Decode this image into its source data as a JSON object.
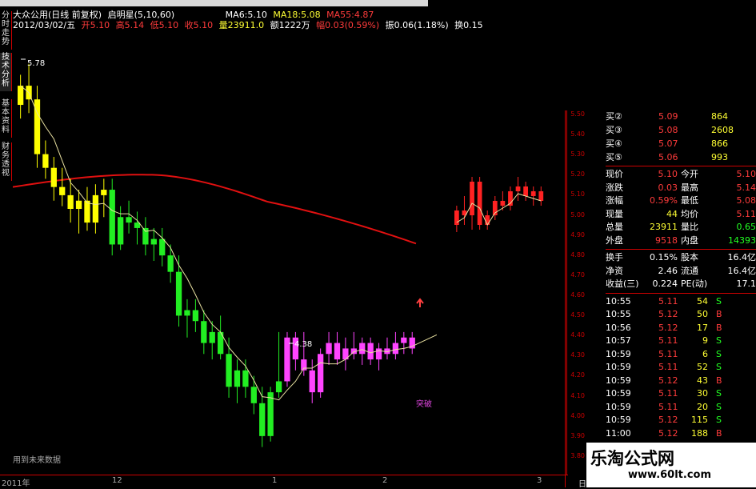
{
  "header": {
    "title": "大众公用(日线 前复权)",
    "indicator": "启明星(5,10,60)",
    "ma": [
      {
        "label": "MA6:",
        "value": "5.10"
      },
      {
        "label": "MA18:",
        "value": "5.08"
      },
      {
        "label": "MA55:",
        "value": "4.87"
      }
    ],
    "date": "2012/03/02/五",
    "open": "开5.10",
    "high": "高5.14",
    "low": "低5.10",
    "close": "收5.10",
    "volume": "量23911.0",
    "amount": "额1222万",
    "change": "幅0.03(0.59%)",
    "amplitude": "振0.06(1.18%)",
    "turnover": "换0.15"
  },
  "left_tabs": [
    "分时走势",
    "技术分析",
    "基本资料",
    "财务透视"
  ],
  "chart": {
    "high_label": "5.78",
    "low_label": "4.38",
    "signal_label": "突破",
    "footer_note": "用到未来数据"
  },
  "x_axis": {
    "labels": [
      "2011年",
      "12",
      "1",
      "2",
      "3"
    ]
  },
  "y_axis": {
    "ticks": [
      "5.50",
      "5.40",
      "5.30",
      "5.20",
      "5.10",
      "5.00",
      "4.90",
      "4.80",
      "4.70",
      "4.60",
      "4.50",
      "4.40",
      "4.30",
      "4.20",
      "4.10",
      "4.00",
      "3.90",
      "3.80"
    ]
  },
  "quote_panel": {
    "bids": [
      {
        "label": "买②",
        "price": "5.09",
        "vol": "864"
      },
      {
        "label": "买③",
        "price": "5.08",
        "vol": "2608"
      },
      {
        "label": "买④",
        "price": "5.07",
        "vol": "866"
      },
      {
        "label": "买⑤",
        "price": "5.06",
        "vol": "993"
      }
    ],
    "stats": [
      {
        "l1": "现价",
        "v1": "5.10",
        "l2": "今开",
        "v2": "5.10"
      },
      {
        "l1": "涨跌",
        "v1": "0.03",
        "l2": "最高",
        "v2": "5.14"
      },
      {
        "l1": "涨幅",
        "v1": "0.59%",
        "l2": "最低",
        "v2": "5.08"
      },
      {
        "l1": "现量",
        "v1": "44",
        "l2": "均价",
        "v2": "5.11"
      },
      {
        "l1": "总量",
        "v1": "23911",
        "l2": "量比",
        "v2": "0.65"
      },
      {
        "l1": "外盘",
        "v1": "9518",
        "l2": "内盘",
        "v2": "14393"
      }
    ],
    "fund": [
      {
        "l1": "换手",
        "v1": "0.15%",
        "l2": "股本",
        "v2": "16.4亿"
      },
      {
        "l1": "净资",
        "v1": "2.46",
        "l2": "流通",
        "v2": "16.4亿"
      },
      {
        "l1": "收益(三)",
        "v1": "0.224",
        "l2": "PE(动)",
        "v2": "17.1"
      }
    ],
    "ticks": [
      {
        "time": "10:55",
        "price": "5.11",
        "vol": "54",
        "side": "S"
      },
      {
        "time": "10:55",
        "price": "5.12",
        "vol": "50",
        "side": "B"
      },
      {
        "time": "10:56",
        "price": "5.12",
        "vol": "17",
        "side": "B"
      },
      {
        "time": "10:57",
        "price": "5.11",
        "vol": "9",
        "side": "S"
      },
      {
        "time": "10:59",
        "price": "5.11",
        "vol": "6",
        "side": "S"
      },
      {
        "time": "10:59",
        "price": "5.11",
        "vol": "52",
        "side": "S"
      },
      {
        "time": "10:59",
        "price": "5.12",
        "vol": "43",
        "side": "B"
      },
      {
        "time": "10:59",
        "price": "5.11",
        "vol": "30",
        "side": "S"
      },
      {
        "time": "10:59",
        "price": "5.11",
        "vol": "20",
        "side": "S"
      },
      {
        "time": "10:59",
        "price": "5.12",
        "vol": "115",
        "side": "S"
      },
      {
        "time": "11:00",
        "price": "5.12",
        "vol": "188",
        "side": "B"
      }
    ]
  },
  "bottom": {
    "period": "日线"
  },
  "watermark": {
    "line1": "乐淘公式网",
    "line2": "www.60lt.com"
  },
  "candles": [
    {
      "o": 5.63,
      "h": 5.74,
      "l": 5.58,
      "c": 5.7,
      "color": "yellow"
    },
    {
      "o": 5.7,
      "h": 5.78,
      "l": 5.6,
      "c": 5.65,
      "color": "yellow"
    },
    {
      "o": 5.65,
      "h": 5.7,
      "l": 5.4,
      "c": 5.45,
      "color": "yellow"
    },
    {
      "o": 5.45,
      "h": 5.5,
      "l": 5.36,
      "c": 5.4,
      "color": "yellow"
    },
    {
      "o": 5.4,
      "h": 5.44,
      "l": 5.28,
      "c": 5.33,
      "color": "yellow"
    },
    {
      "o": 5.33,
      "h": 5.4,
      "l": 5.26,
      "c": 5.3,
      "color": "yellow"
    },
    {
      "o": 5.3,
      "h": 5.36,
      "l": 5.2,
      "c": 5.25,
      "color": "yellow"
    },
    {
      "o": 5.25,
      "h": 5.32,
      "l": 5.16,
      "c": 5.28,
      "color": "yellow"
    },
    {
      "o": 5.28,
      "h": 5.33,
      "l": 5.17,
      "c": 5.2,
      "color": "yellow"
    },
    {
      "o": 5.2,
      "h": 5.34,
      "l": 5.16,
      "c": 5.3,
      "color": "yellow"
    },
    {
      "o": 5.3,
      "h": 5.36,
      "l": 5.22,
      "c": 5.32,
      "color": "yellow"
    },
    {
      "o": 5.32,
      "h": 5.36,
      "l": 5.08,
      "c": 5.12,
      "color": "green"
    },
    {
      "o": 5.12,
      "h": 5.26,
      "l": 5.1,
      "c": 5.22,
      "color": "green"
    },
    {
      "o": 5.22,
      "h": 5.28,
      "l": 5.16,
      "c": 5.2,
      "color": "green"
    },
    {
      "o": 5.2,
      "h": 5.24,
      "l": 5.12,
      "c": 5.18,
      "color": "green"
    },
    {
      "o": 5.18,
      "h": 5.22,
      "l": 5.08,
      "c": 5.12,
      "color": "green"
    },
    {
      "o": 5.12,
      "h": 5.18,
      "l": 5.06,
      "c": 5.14,
      "color": "green"
    },
    {
      "o": 5.14,
      "h": 5.18,
      "l": 5.04,
      "c": 5.08,
      "color": "green"
    },
    {
      "o": 5.08,
      "h": 5.12,
      "l": 4.98,
      "c": 5.02,
      "color": "green"
    },
    {
      "o": 5.02,
      "h": 5.08,
      "l": 4.82,
      "c": 4.86,
      "color": "green"
    },
    {
      "o": 4.86,
      "h": 4.92,
      "l": 4.78,
      "c": 4.88,
      "color": "green"
    },
    {
      "o": 4.88,
      "h": 4.92,
      "l": 4.8,
      "c": 4.84,
      "color": "green"
    },
    {
      "o": 4.84,
      "h": 4.88,
      "l": 4.72,
      "c": 4.76,
      "color": "green"
    },
    {
      "o": 4.76,
      "h": 4.84,
      "l": 4.7,
      "c": 4.8,
      "color": "green"
    },
    {
      "o": 4.8,
      "h": 4.86,
      "l": 4.7,
      "c": 4.72,
      "color": "green"
    },
    {
      "o": 4.72,
      "h": 4.78,
      "l": 4.56,
      "c": 4.6,
      "color": "green"
    },
    {
      "o": 4.6,
      "h": 4.7,
      "l": 4.54,
      "c": 4.66,
      "color": "green"
    },
    {
      "o": 4.66,
      "h": 4.7,
      "l": 4.56,
      "c": 4.6,
      "color": "green"
    },
    {
      "o": 4.6,
      "h": 4.64,
      "l": 4.5,
      "c": 4.54,
      "color": "green"
    },
    {
      "o": 4.54,
      "h": 4.6,
      "l": 4.38,
      "c": 4.42,
      "color": "green"
    },
    {
      "o": 4.42,
      "h": 4.6,
      "l": 4.4,
      "c": 4.58,
      "color": "green"
    },
    {
      "o": 4.58,
      "h": 4.8,
      "l": 4.56,
      "c": 4.62,
      "color": "green"
    },
    {
      "o": 4.62,
      "h": 4.8,
      "l": 4.6,
      "c": 4.78,
      "color": "magenta"
    },
    {
      "o": 4.78,
      "h": 4.8,
      "l": 4.66,
      "c": 4.7,
      "color": "magenta"
    },
    {
      "o": 4.7,
      "h": 4.8,
      "l": 4.64,
      "c": 4.66,
      "color": "magenta"
    },
    {
      "o": 4.66,
      "h": 4.7,
      "l": 4.54,
      "c": 4.58,
      "color": "magenta"
    },
    {
      "o": 4.58,
      "h": 4.74,
      "l": 4.56,
      "c": 4.72,
      "color": "magenta"
    },
    {
      "o": 4.72,
      "h": 4.8,
      "l": 4.68,
      "c": 4.76,
      "color": "magenta"
    },
    {
      "o": 4.76,
      "h": 4.8,
      "l": 4.68,
      "c": 4.7,
      "color": "magenta"
    },
    {
      "o": 4.7,
      "h": 4.78,
      "l": 4.66,
      "c": 4.74,
      "color": "magenta"
    },
    {
      "o": 4.74,
      "h": 4.8,
      "l": 4.7,
      "c": 4.72,
      "color": "magenta"
    },
    {
      "o": 4.72,
      "h": 4.78,
      "l": 4.68,
      "c": 4.76,
      "color": "magenta"
    },
    {
      "o": 4.76,
      "h": 4.78,
      "l": 4.68,
      "c": 4.7,
      "color": "magenta"
    },
    {
      "o": 4.7,
      "h": 4.76,
      "l": 4.66,
      "c": 4.74,
      "color": "magenta"
    },
    {
      "o": 4.74,
      "h": 4.78,
      "l": 4.7,
      "c": 4.72,
      "color": "magenta"
    },
    {
      "o": 4.72,
      "h": 4.8,
      "l": 4.7,
      "c": 4.76,
      "color": "magenta"
    },
    {
      "o": 4.76,
      "h": 4.8,
      "l": 4.72,
      "c": 4.78,
      "color": "magenta"
    },
    {
      "o": 4.78,
      "h": 4.8,
      "l": 4.72,
      "c": 4.74,
      "color": "magenta"
    }
  ],
  "detail_candles": [
    {
      "o": 5.0,
      "h": 5.08,
      "l": 4.97,
      "c": 5.06,
      "color": "red"
    },
    {
      "o": 5.06,
      "h": 5.12,
      "l": 5.0,
      "c": 5.04,
      "color": "red"
    },
    {
      "o": 5.04,
      "h": 5.2,
      "l": 4.98,
      "c": 5.18,
      "color": "red"
    },
    {
      "o": 5.18,
      "h": 5.2,
      "l": 4.98,
      "c": 5.0,
      "color": "red"
    },
    {
      "o": 5.0,
      "h": 5.06,
      "l": 4.98,
      "c": 5.04,
      "color": "red"
    },
    {
      "o": 5.04,
      "h": 5.12,
      "l": 5.02,
      "c": 5.1,
      "color": "red"
    },
    {
      "o": 5.1,
      "h": 5.14,
      "l": 5.06,
      "c": 5.08,
      "color": "red"
    },
    {
      "o": 5.08,
      "h": 5.16,
      "l": 5.06,
      "c": 5.14,
      "color": "red"
    },
    {
      "o": 5.14,
      "h": 5.2,
      "l": 5.1,
      "c": 5.16,
      "color": "red"
    },
    {
      "o": 5.16,
      "h": 5.18,
      "l": 5.1,
      "c": 5.12,
      "color": "red"
    },
    {
      "o": 5.12,
      "h": 5.16,
      "l": 5.08,
      "c": 5.14,
      "color": "red"
    },
    {
      "o": 5.14,
      "h": 5.16,
      "l": 5.08,
      "c": 5.1,
      "color": "red"
    }
  ],
  "colors": {
    "yellow": "#ffff00",
    "green": "#22ee22",
    "magenta": "#ff44ff",
    "red": "#ff2222",
    "ma_long": "#e01010",
    "ma_short": "#e8e0a0",
    "axis": "#cc0000"
  }
}
